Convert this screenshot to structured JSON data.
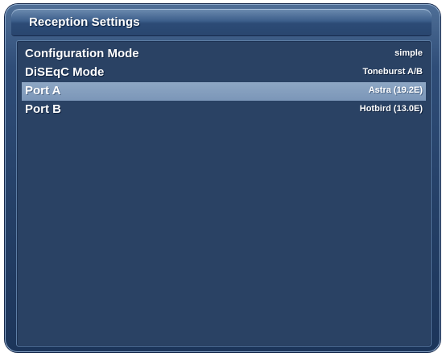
{
  "window": {
    "title": "Reception Settings"
  },
  "settings": [
    {
      "label": "Configuration Mode",
      "value": "simple",
      "selected": false
    },
    {
      "label": "DiSEqC Mode",
      "value": "Toneburst A/B",
      "selected": false
    },
    {
      "label": "Port A",
      "value": "Astra (19.2E)",
      "selected": true
    },
    {
      "label": "Port B",
      "value": "Hotbird (13.0E)",
      "selected": false
    }
  ],
  "colors": {
    "frame": "#2f4d78",
    "panel_background": "#2a4264",
    "selection_highlight": "#7b96b8",
    "text": "#ffffff"
  }
}
